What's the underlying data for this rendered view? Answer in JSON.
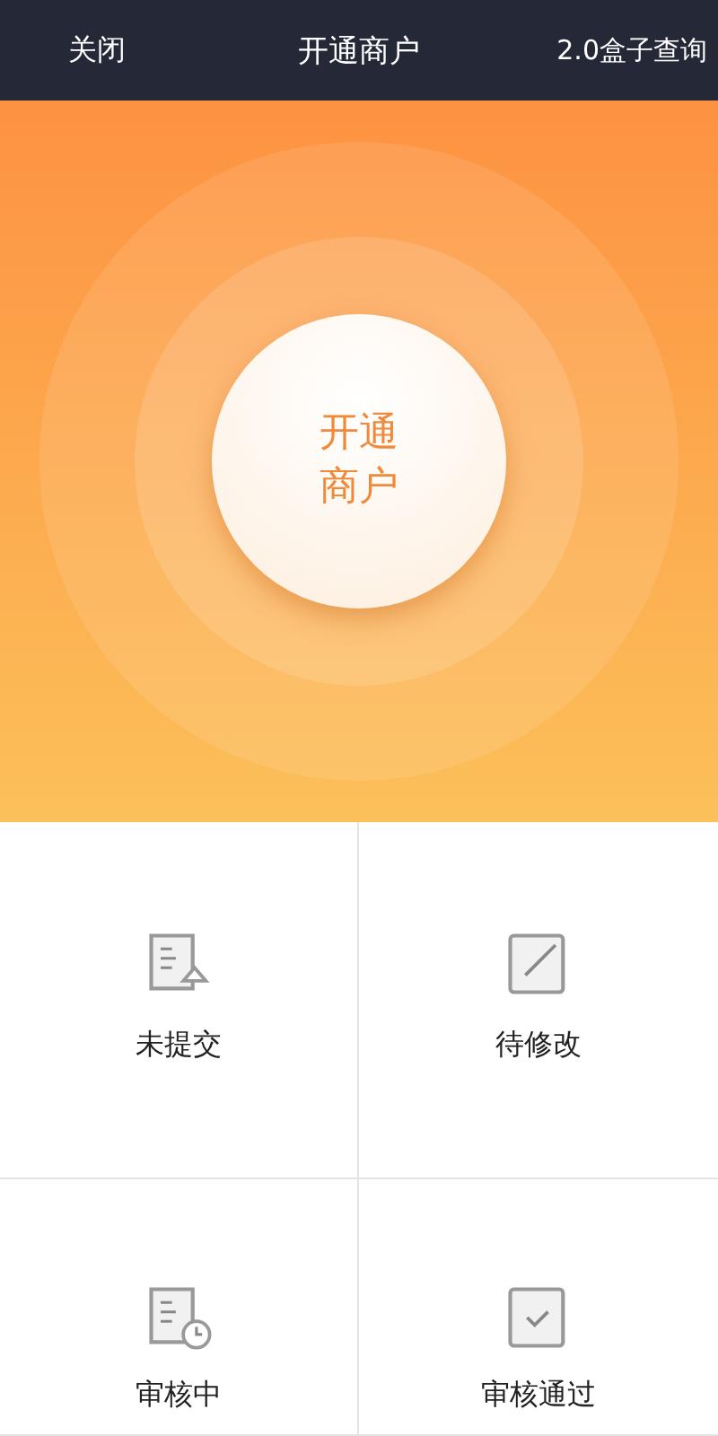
{
  "header": {
    "close": "关闭",
    "title": "开通商户",
    "action": "2.0盒子查询"
  },
  "hero": {
    "button": "开通商户"
  },
  "statuses": [
    {
      "kind": "draft",
      "label": "未提交"
    },
    {
      "kind": "edit",
      "label": "待修改"
    },
    {
      "kind": "reviewing",
      "label": "审核中"
    },
    {
      "kind": "approved",
      "label": "审核通过"
    }
  ]
}
